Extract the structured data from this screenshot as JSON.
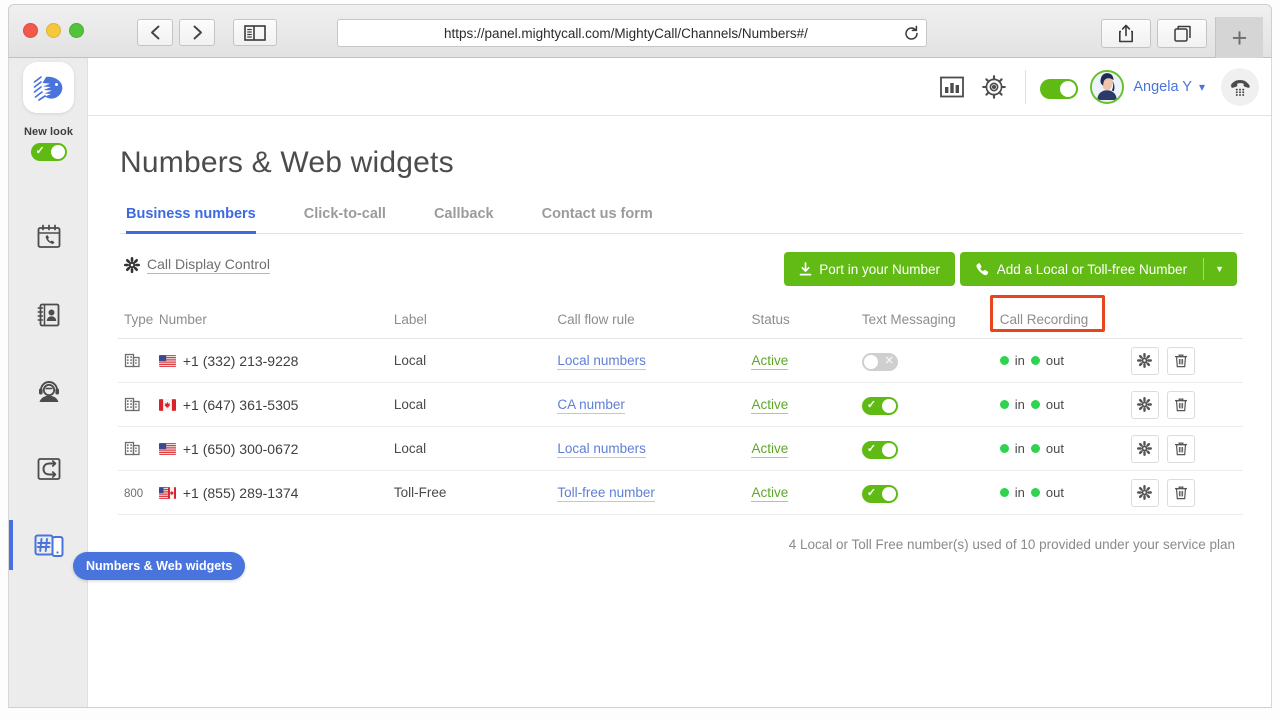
{
  "browser": {
    "url": "https://panel.mightycall.com/MightyCall/Channels/Numbers#/",
    "back_label": "Back",
    "forward_label": "Forward",
    "sidebar_toggle_label": "Show sidebar",
    "reload_label": "Reload",
    "share_label": "Share",
    "tabs_label": "Show all tabs",
    "new_tab_label": "+"
  },
  "leftnav": {
    "logo_name": "mightycall-logo",
    "new_look": {
      "label": "New look",
      "state": "on"
    },
    "items": [
      {
        "name": "call-history",
        "label": "Call history",
        "active": false
      },
      {
        "name": "contacts",
        "label": "Contacts",
        "active": false
      },
      {
        "name": "agents",
        "label": "Agents",
        "active": false
      },
      {
        "name": "call-flow",
        "label": "Call flow",
        "active": false
      },
      {
        "name": "numbers-web-widgets",
        "label": "Numbers & Web widgets",
        "active": true
      }
    ],
    "tooltip": "Numbers & Web widgets"
  },
  "topbar": {
    "reports_label": "Reports",
    "settings_label": "Settings",
    "availability_toggle": "on",
    "user_name": "Angela Y",
    "dialpad_label": "Dialpad"
  },
  "page": {
    "title": "Numbers & Web widgets",
    "tabs": [
      {
        "label": "Business numbers",
        "active": true
      },
      {
        "label": "Click-to-call",
        "active": false
      },
      {
        "label": "Callback",
        "active": false
      },
      {
        "label": "Contact us form",
        "active": false
      }
    ],
    "call_display_control": "Call Display Control",
    "port_button": "Port in your Number",
    "add_button": "Add a Local or Toll-free Number",
    "footnote": "4 Local or Toll Free number(s) used of 10 provided under your service plan"
  },
  "table": {
    "headers": [
      "Type",
      "Number",
      "Label",
      "Call flow rule",
      "Status",
      "Text Messaging",
      "Call Recording",
      ""
    ],
    "highlighted_header": "Call Recording",
    "rows": [
      {
        "type": "building",
        "type_text": "",
        "flag": "us",
        "number": "+1 (332) 213-9228",
        "label": "Local",
        "call_flow_rule": "Local numbers",
        "status": "Active",
        "text_messaging": "off",
        "recording_in": "in",
        "recording_out": "out"
      },
      {
        "type": "building",
        "type_text": "",
        "flag": "ca",
        "number": "+1 (647) 361-5305",
        "label": "Local",
        "call_flow_rule": "CA number",
        "status": "Active",
        "text_messaging": "on",
        "recording_in": "in",
        "recording_out": "out"
      },
      {
        "type": "building",
        "type_text": "",
        "flag": "us",
        "number": "+1 (650) 300-0672",
        "label": "Local",
        "call_flow_rule": "Local numbers",
        "status": "Active",
        "text_messaging": "on",
        "recording_in": "in",
        "recording_out": "out"
      },
      {
        "type": "text",
        "type_text": "800",
        "flag": "usca",
        "number": "+1 (855) 289-1374",
        "label": "Toll-Free",
        "call_flow_rule": "Toll-free number",
        "status": "Active",
        "text_messaging": "on",
        "recording_in": "in",
        "recording_out": "out"
      }
    ],
    "row_actions": {
      "settings": "Settings",
      "delete": "Delete"
    }
  },
  "colors": {
    "green": "#62bb14",
    "blue": "#3d6ae0",
    "link_blue": "#5f7fd6",
    "status_green": "#5fa628",
    "highlight_red": "#e8441d",
    "dot_green": "#2ed34f"
  }
}
